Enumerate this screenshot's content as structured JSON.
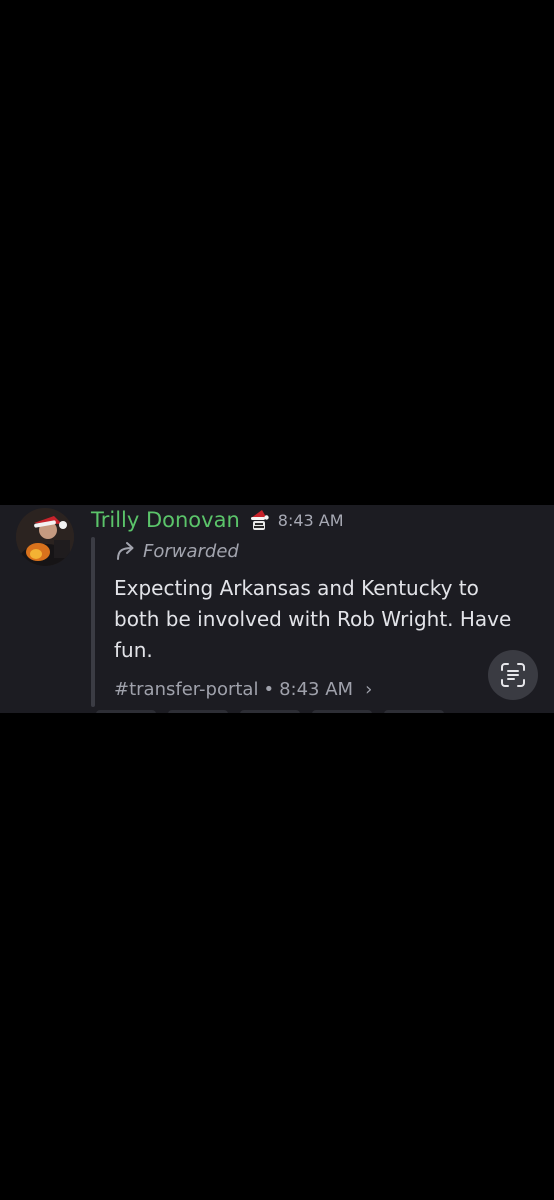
{
  "message": {
    "author": "Trilly Donovan",
    "author_color": "#5bc46a",
    "timestamp": "8:43 AM",
    "role_icon": "santa-hat-badge-icon",
    "forwarded_label": "Forwarded",
    "forward_icon": "forward-arrow-icon",
    "text": "Expecting Arkansas and Kentucky to both be involved with Rob Wright. Have fun.",
    "source_channel": "#transfer-portal",
    "separator": "•",
    "source_time": "8:43 AM",
    "chevron": "›"
  },
  "overlay": {
    "scan_icon": "text-scan-icon"
  },
  "colors": {
    "background": "#000000",
    "card": "#1c1c22",
    "text": "#e2e3e8",
    "muted": "#a7a9b4"
  }
}
